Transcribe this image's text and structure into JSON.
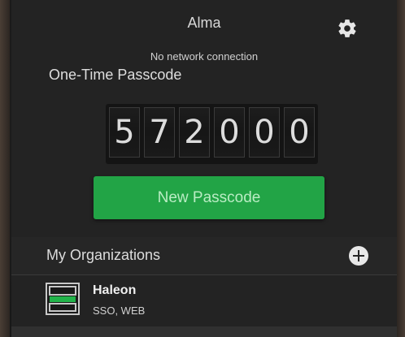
{
  "app": {
    "title": "Alma",
    "settings_icon": "gear-icon"
  },
  "status": {
    "message": "No network connection"
  },
  "passcode": {
    "label": "One-Time Passcode",
    "digits": [
      "5",
      "7",
      "2",
      "0",
      "0",
      "0"
    ]
  },
  "actions": {
    "new_passcode_label": "New Passcode",
    "button_color": "#22a446"
  },
  "organizations": {
    "header": "My Organizations",
    "add_icon": "plus-circle-icon",
    "items": [
      {
        "name": "Haleon",
        "types": "SSO, WEB",
        "icon": "organization-logo-icon"
      }
    ]
  }
}
